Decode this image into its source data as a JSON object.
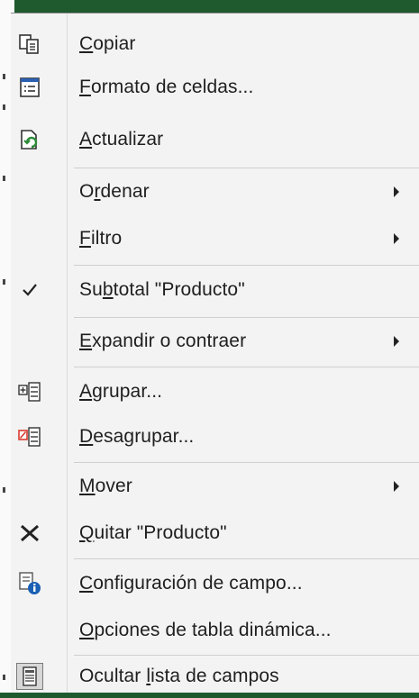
{
  "menu": {
    "items": [
      {
        "key": "C",
        "rest": "opiar",
        "icon": "copy-icon"
      },
      {
        "key": "F",
        "rest": "ormato de celdas...",
        "icon": "format-cells-icon"
      },
      {
        "key": "A",
        "rest": "ctualizar",
        "icon": "refresh-icon"
      },
      {
        "pre": "O",
        "key": "r",
        "rest": "denar",
        "submenu": true
      },
      {
        "key": "F",
        "rest": "iltro",
        "submenu": true
      },
      {
        "pre": "Su",
        "key": "b",
        "rest": "total \"Producto\"",
        "icon": "checkmark-icon",
        "checked": true
      },
      {
        "key": "E",
        "rest": "xpandir o contraer",
        "submenu": true
      },
      {
        "key": "A",
        "rest": "grupar...",
        "icon": "group-icon"
      },
      {
        "key": "D",
        "rest": "esagrupar...",
        "icon": "ungroup-icon"
      },
      {
        "key": "M",
        "rest": "over",
        "submenu": true
      },
      {
        "key": "Q",
        "rest": "uitar \"Producto\"",
        "icon": "remove-x-icon"
      },
      {
        "key": "C",
        "rest": "onfiguración de campo...",
        "icon": "field-settings-icon"
      },
      {
        "key": "O",
        "rest": "pciones de tabla dinámica..."
      },
      {
        "pre": "Ocultar ",
        "key": "l",
        "rest": "ista de campos",
        "icon": "field-list-icon"
      }
    ]
  },
  "colors": {
    "accent": "#1e5a2e",
    "refresh": "#2e8b3a",
    "ungroup": "#d83b2f",
    "info": "#1a5fb4"
  }
}
